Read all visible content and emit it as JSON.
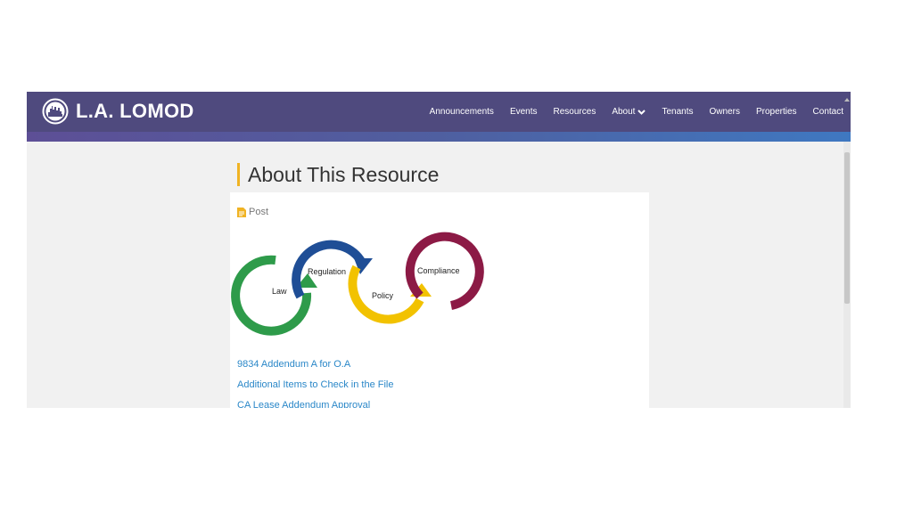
{
  "header": {
    "brand": "L.A. LOMOD",
    "nav": [
      {
        "label": "Announcements"
      },
      {
        "label": "Events"
      },
      {
        "label": "Resources"
      },
      {
        "label": "About",
        "has_dropdown": true
      },
      {
        "label": "Tenants"
      },
      {
        "label": "Owners"
      },
      {
        "label": "Properties"
      },
      {
        "label": "Contact"
      }
    ]
  },
  "main": {
    "title": "About This Resource",
    "post_type": "Post",
    "diagram": {
      "labels": {
        "law": "Law",
        "regulation": "Regulation",
        "policy": "Policy",
        "compliance": "Compliance"
      },
      "colors": {
        "law": "#2e9b4a",
        "regulation": "#1f4e96",
        "policy": "#f2c200",
        "compliance": "#8c1a45"
      }
    },
    "links": [
      "9834 Addendum A for O.A",
      "Additional Items to Check in the File",
      "CA Lease Addendum Approval"
    ]
  },
  "colors": {
    "navbar": "#4f4a7e",
    "accent": "#f0b323",
    "link": "#2a87c8"
  }
}
